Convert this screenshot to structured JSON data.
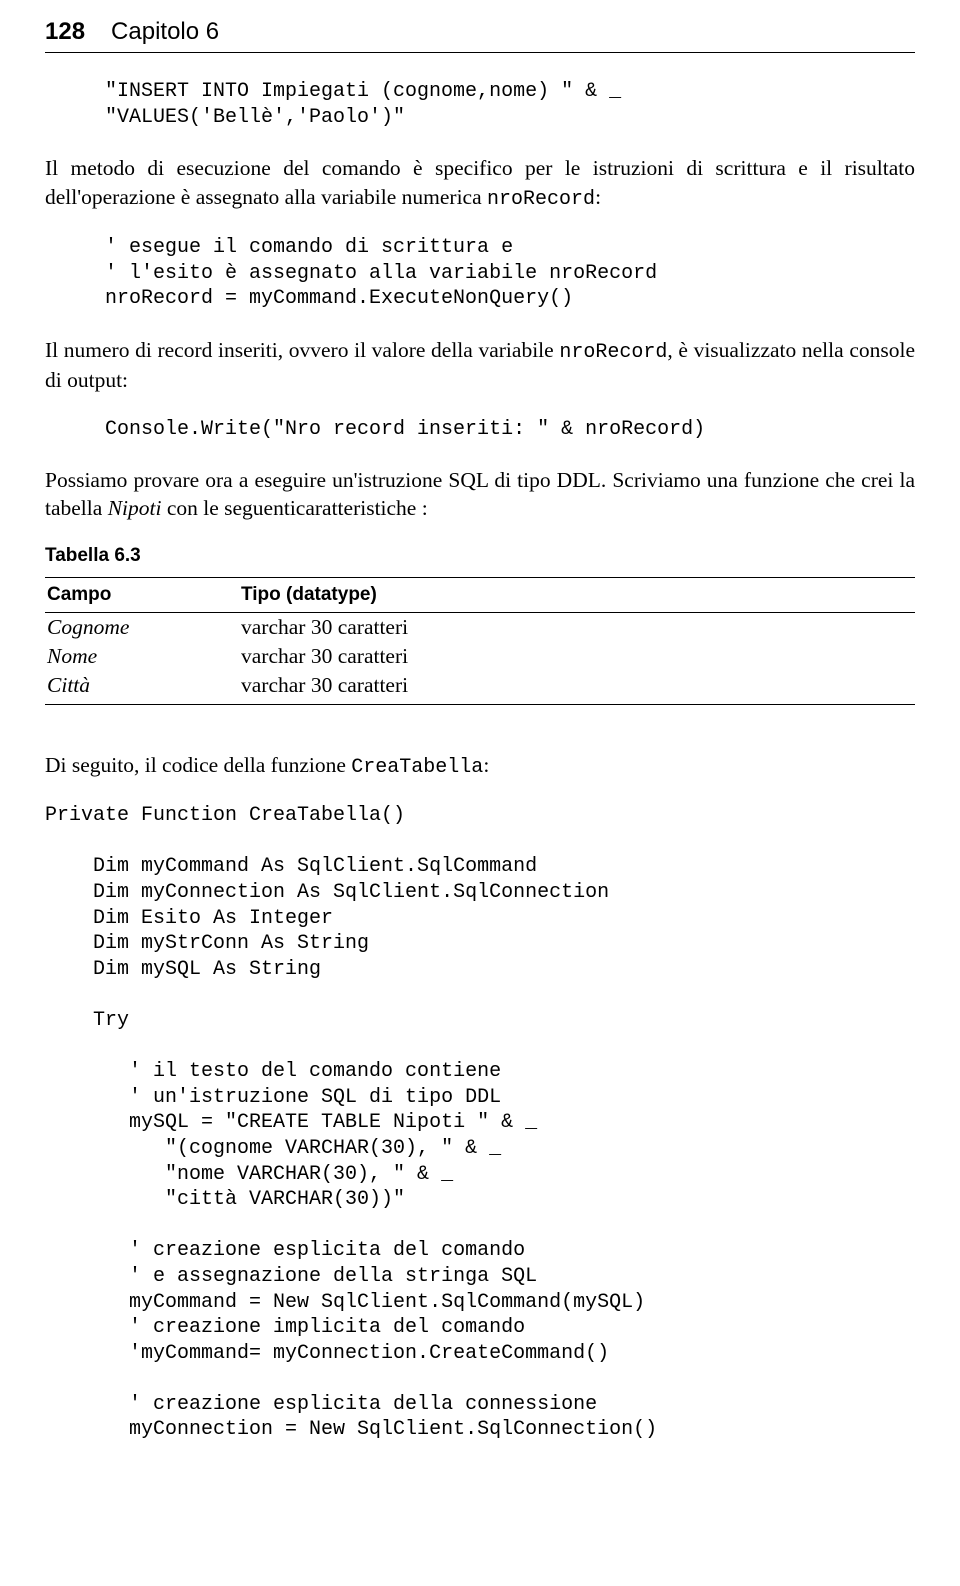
{
  "header": {
    "page_num": "128",
    "chapter": "Capitolo 6"
  },
  "code1": "\"INSERT INTO Impiegati (cognome,nome) \" & _\n\"VALUES('Bellè','Paolo')\"",
  "para1_a": "Il metodo di esecuzione del comando è specifico per le istruzioni di scrittura e il risultato dell'operazione è assegnato alla variabile numerica ",
  "para1_mono": "nroRecord",
  "para1_b": ":",
  "code2": "' esegue il comando di scrittura e\n' l'esito è assegnato alla variabile nroRecord\nnroRecord = myCommand.ExecuteNonQuery()",
  "para2_a": "Il numero di record inseriti, ovvero il valore della variabile ",
  "para2_mono": "nroRecord",
  "para2_b": ", è visualizzato nella console di output:",
  "code3": "Console.Write(\"Nro record inseriti: \" & nroRecord)",
  "para3_a": "Possiamo provare ora a eseguire un'istruzione SQL di tipo DDL. Scriviamo una funzione che crei la tabella ",
  "para3_italic": "Nipoti",
  "para3_b": " con le seguenticaratteristiche :",
  "table_label": "Tabella 6.3",
  "table": {
    "headers": [
      "Campo",
      "Tipo (datatype)"
    ],
    "rows": [
      [
        "Cognome",
        "varchar 30 caratteri"
      ],
      [
        "Nome",
        "varchar 30 caratteri"
      ],
      [
        "Città",
        "varchar 30 caratteri"
      ]
    ]
  },
  "para4_a": "Di seguito, il codice della funzione ",
  "para4_mono": "CreaTabella",
  "para4_b": ":",
  "code4": "Private Function CreaTabella()\n\n    Dim myCommand As SqlClient.SqlCommand\n    Dim myConnection As SqlClient.SqlConnection\n    Dim Esito As Integer\n    Dim myStrConn As String\n    Dim mySQL As String\n\n    Try\n\n       ' il testo del comando contiene\n       ' un'istruzione SQL di tipo DDL\n       mySQL = \"CREATE TABLE Nipoti \" & _\n          \"(cognome VARCHAR(30), \" & _\n          \"nome VARCHAR(30), \" & _\n          \"città VARCHAR(30))\"\n\n       ' creazione esplicita del comando\n       ' e assegnazione della stringa SQL\n       myCommand = New SqlClient.SqlCommand(mySQL)\n       ' creazione implicita del comando\n       'myCommand= myConnection.CreateCommand()\n\n       ' creazione esplicita della connessione\n       myConnection = New SqlClient.SqlConnection()"
}
